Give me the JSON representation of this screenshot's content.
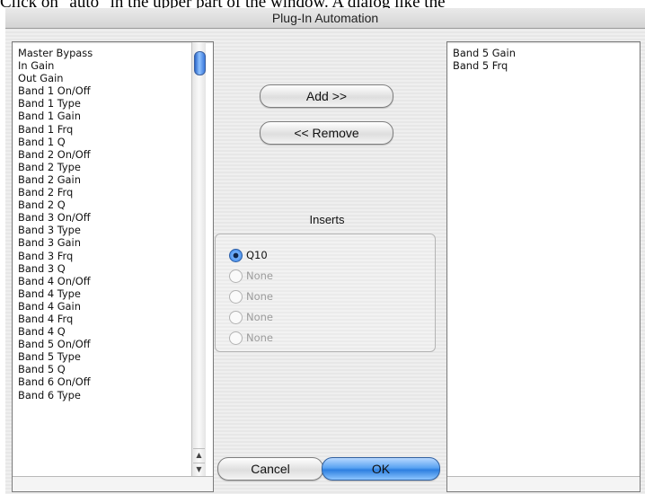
{
  "caption": "Click on \"auto\" in the upper part of the window. A dialog like the",
  "window": {
    "title": "Plug-In Automation"
  },
  "available_params": [
    "Master Bypass",
    "In Gain",
    "Out Gain",
    "Band 1 On/Off",
    "Band 1 Type",
    "Band 1 Gain",
    "Band 1 Frq",
    "Band 1 Q",
    "Band 2 On/Off",
    "Band 2 Type",
    "Band 2 Gain",
    "Band 2 Frq",
    "Band 2 Q",
    "Band 3 On/Off",
    "Band 3 Type",
    "Band 3 Gain",
    "Band 3 Frq",
    "Band 3 Q",
    "Band 4 On/Off",
    "Band 4 Type",
    "Band 4 Gain",
    "Band 4 Frq",
    "Band 4 Q",
    "Band 5 On/Off",
    "Band 5 Type",
    "Band 5 Q",
    "Band 6 On/Off",
    "Band 6 Type"
  ],
  "automated_params": [
    "Band 5 Gain",
    "Band 5 Frq"
  ],
  "buttons": {
    "add": "Add >>",
    "remove": "<< Remove",
    "cancel": "Cancel",
    "ok": "OK"
  },
  "inserts": {
    "label": "Inserts",
    "options": [
      {
        "label": "Q10",
        "selected": true,
        "enabled": true
      },
      {
        "label": "None",
        "selected": false,
        "enabled": false
      },
      {
        "label": "None",
        "selected": false,
        "enabled": false
      },
      {
        "label": "None",
        "selected": false,
        "enabled": false
      },
      {
        "label": "None",
        "selected": false,
        "enabled": false
      }
    ]
  },
  "icons": {
    "scroll_up": "scroll-up-arrow-icon",
    "scroll_down": "scroll-down-arrow-icon"
  },
  "colors": {
    "default_button": "#4a97ee",
    "scroll_thumb": "#3a78dc"
  }
}
